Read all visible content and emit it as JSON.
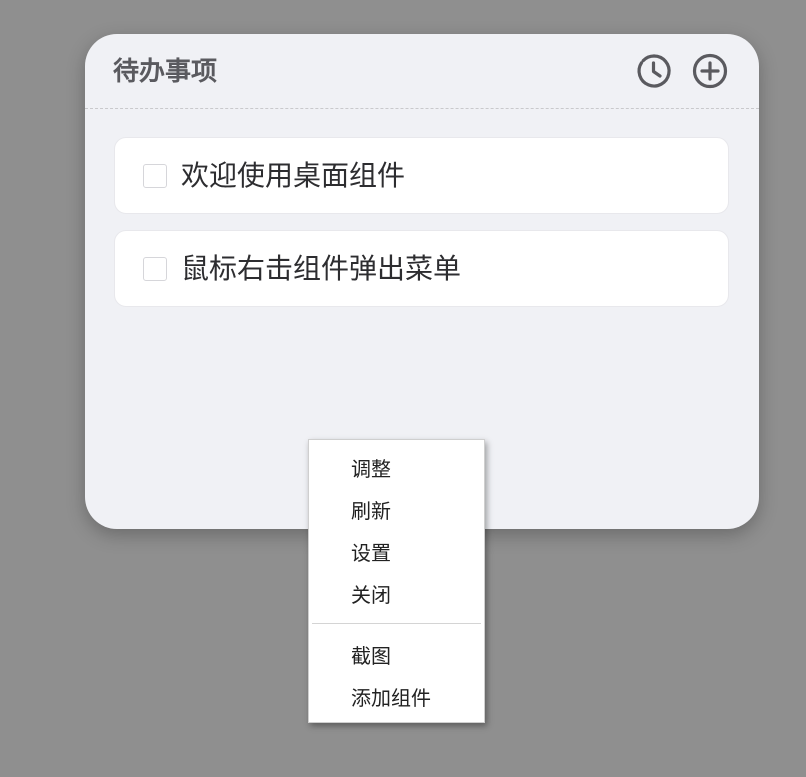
{
  "widget": {
    "title": "待办事项",
    "history_icon": "history-clock-icon",
    "add_icon": "plus-circle-icon"
  },
  "todos": [
    {
      "text": "欢迎使用桌面组件",
      "checked": false
    },
    {
      "text": "鼠标右击组件弹出菜单",
      "checked": false
    }
  ],
  "context_menu": {
    "items": [
      "调整",
      "刷新",
      "设置",
      "关闭",
      "截图",
      "添加组件"
    ]
  },
  "colors": {
    "desktop_bg": "#8f8f8f",
    "widget_bg": "#f0f1f5",
    "icon": "#5a5a5f"
  }
}
